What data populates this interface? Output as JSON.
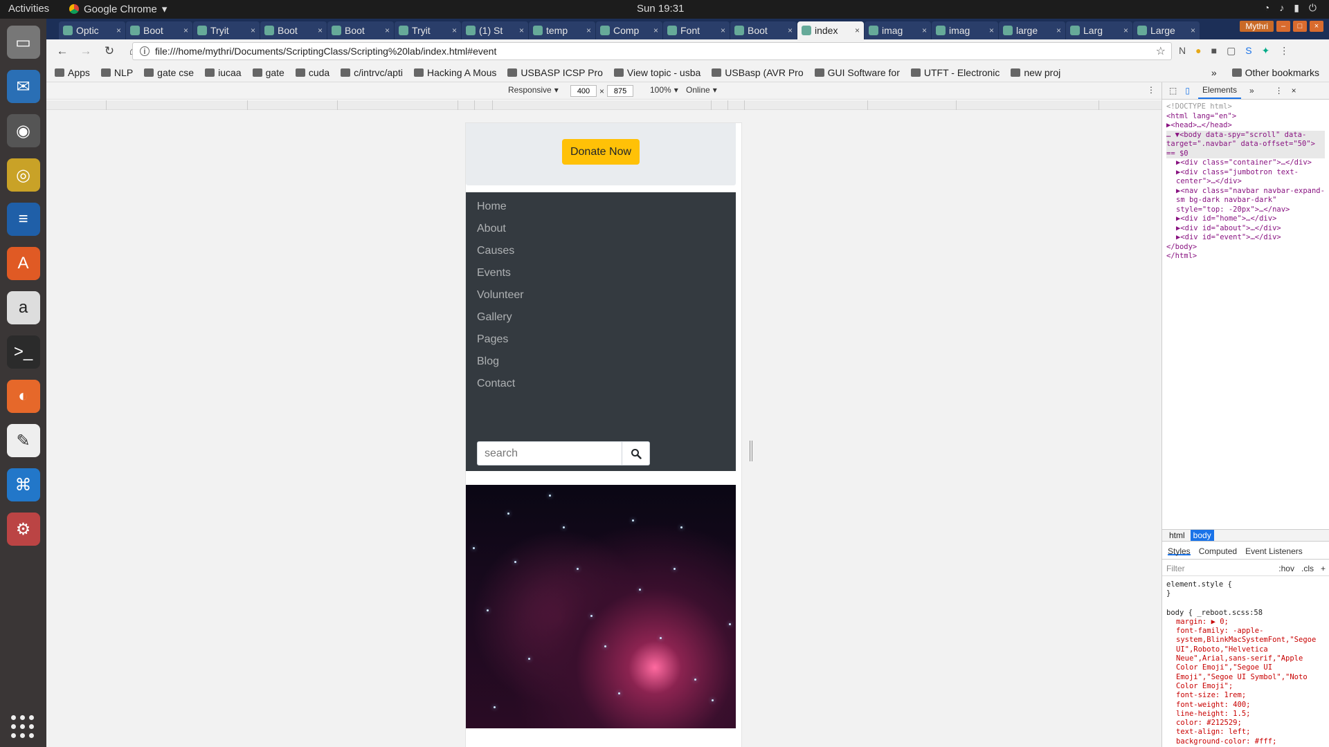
{
  "topbar": {
    "activities": "Activities",
    "app": "Google Chrome",
    "clock": "Sun 19:31"
  },
  "tabs": [
    {
      "label": "Optic"
    },
    {
      "label": "Boot"
    },
    {
      "label": "Tryit"
    },
    {
      "label": "Boot"
    },
    {
      "label": "Boot"
    },
    {
      "label": "Tryit"
    },
    {
      "label": "(1) St"
    },
    {
      "label": "temp"
    },
    {
      "label": "Comp"
    },
    {
      "label": "Font"
    },
    {
      "label": "Boot"
    },
    {
      "label": "index",
      "active": true
    },
    {
      "label": "imag"
    },
    {
      "label": "imag"
    },
    {
      "label": "large"
    },
    {
      "label": "Larg"
    },
    {
      "label": "Large"
    }
  ],
  "window": {
    "user": "Mythri"
  },
  "omnibox": {
    "url": "file:///home/mythri/Documents/ScriptingClass/Scripting%20lab/index.html#event"
  },
  "bookmarks": [
    "Apps",
    "NLP",
    "gate cse",
    "iucaa",
    "gate",
    "cuda",
    "c/intrvc/apti",
    "Hacking A Mous",
    "USBASP ICSP Pro",
    "View topic - usba",
    "USBasp (AVR Pro",
    "GUI Software for",
    "UTFT - Electronic",
    "new proj"
  ],
  "bookmarks_other": "Other bookmarks",
  "device_bar": {
    "mode": "Responsive",
    "width": "400",
    "height": "875",
    "zoom": "100%",
    "network": "Online"
  },
  "page": {
    "donate": "Donate Now",
    "nav": [
      "Home",
      "About",
      "Causes",
      "Events",
      "Volunteer",
      "Gallery",
      "Pages",
      "Blog",
      "Contact"
    ],
    "search_placeholder": "search"
  },
  "devtools": {
    "tab_elements": "Elements",
    "dom": [
      "<!DOCTYPE html>",
      "<html lang=\"en\">",
      "▶<head>…</head>",
      "… ▼<body data-spy=\"scroll\" data-target=\".navbar\" data-offset=\"50\"> == $0",
      "▶<div class=\"container\">…</div>",
      "▶<div class=\"jumbotron text-center\">…</div>",
      "▶<nav class=\"navbar navbar-expand-sm bg-dark navbar-dark\" style=\"top: -20px\">…</nav>",
      "▶<div id=\"home\">…</div>",
      "▶<div id=\"about\">…</div>",
      "▶<div id=\"event\">…</div>",
      "</body>",
      "</html>"
    ],
    "crumbs": [
      "html",
      "body"
    ],
    "style_tabs": [
      "Styles",
      "Computed",
      "Event Listeners"
    ],
    "filter": "Filter",
    "hov": ":hov",
    "cls": ".cls",
    "styles": [
      "element.style {",
      "}",
      "body {   _reboot.scss:58",
      "margin: ▶ 0;",
      "font-family: -apple-system,BlinkMacSystemFont,\"Segoe UI\",Roboto,\"Helvetica Neue\",Arial,sans-serif,\"Apple Color Emoji\",\"Segoe UI Emoji\",\"Segoe UI Symbol\",\"Noto Color Emoji\";",
      "font-size: 1rem;",
      "font-weight: 400;",
      "line-height: 1.5;",
      "color: #212529;",
      "text-align: left;",
      "background-color: #fff;"
    ]
  }
}
